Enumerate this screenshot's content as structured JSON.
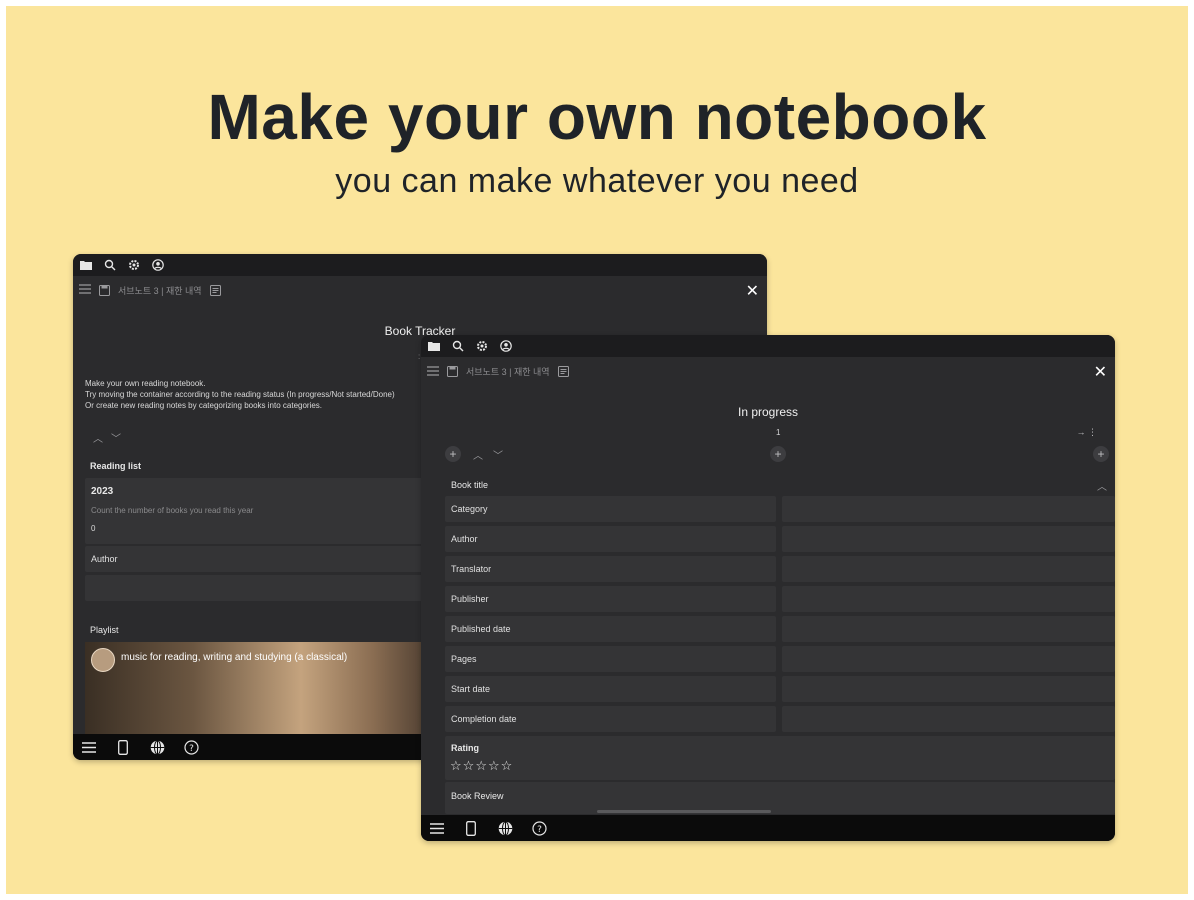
{
  "hero": {
    "title": "Make your own notebook",
    "subtitle": "you can make whatever you need"
  },
  "colors": {
    "background": "#fbe59c",
    "device_bg": "#2b2b2d",
    "device_top": "#1c1c1e",
    "row_bg": "#343436"
  },
  "screen_a": {
    "breadcrumb": "서브노트 3 | 재한 내역",
    "page_title": "Book Tracker",
    "description": [
      "Make your own reading notebook.",
      "Try moving the container according to the reading status (In progress/Not started/Done)",
      "Or create new reading notes by categorizing books into categories."
    ],
    "reading_list_label": "Reading list",
    "year_title": "2023",
    "year_desc": "Count the number of books you read this year",
    "year_count": "0",
    "author_label": "Author",
    "playlist_label": "Playlist",
    "playlist_title": "music for reading, writing and studying (a classical)"
  },
  "screen_b": {
    "breadcrumb": "서브노트 3 | 재한 내역",
    "page_title": "In progress",
    "page_number": "1",
    "book_title_label": "Book title",
    "fields": [
      "Category",
      "Author",
      "Translator",
      "Publisher",
      "Published date",
      "Pages",
      "Start date",
      "Completion date"
    ],
    "rating_label": "Rating",
    "rating_value": 0,
    "rating_max": 5,
    "book_review_label": "Book Review"
  },
  "icons": {
    "folder": "folder-icon",
    "search": "search-icon",
    "gear": "gear-icon",
    "account": "account-icon",
    "menu": "menu-icon",
    "save": "save-icon",
    "note": "note-icon",
    "close": "close-icon",
    "device": "phone-icon",
    "globe": "globe-icon",
    "help": "help-icon"
  }
}
